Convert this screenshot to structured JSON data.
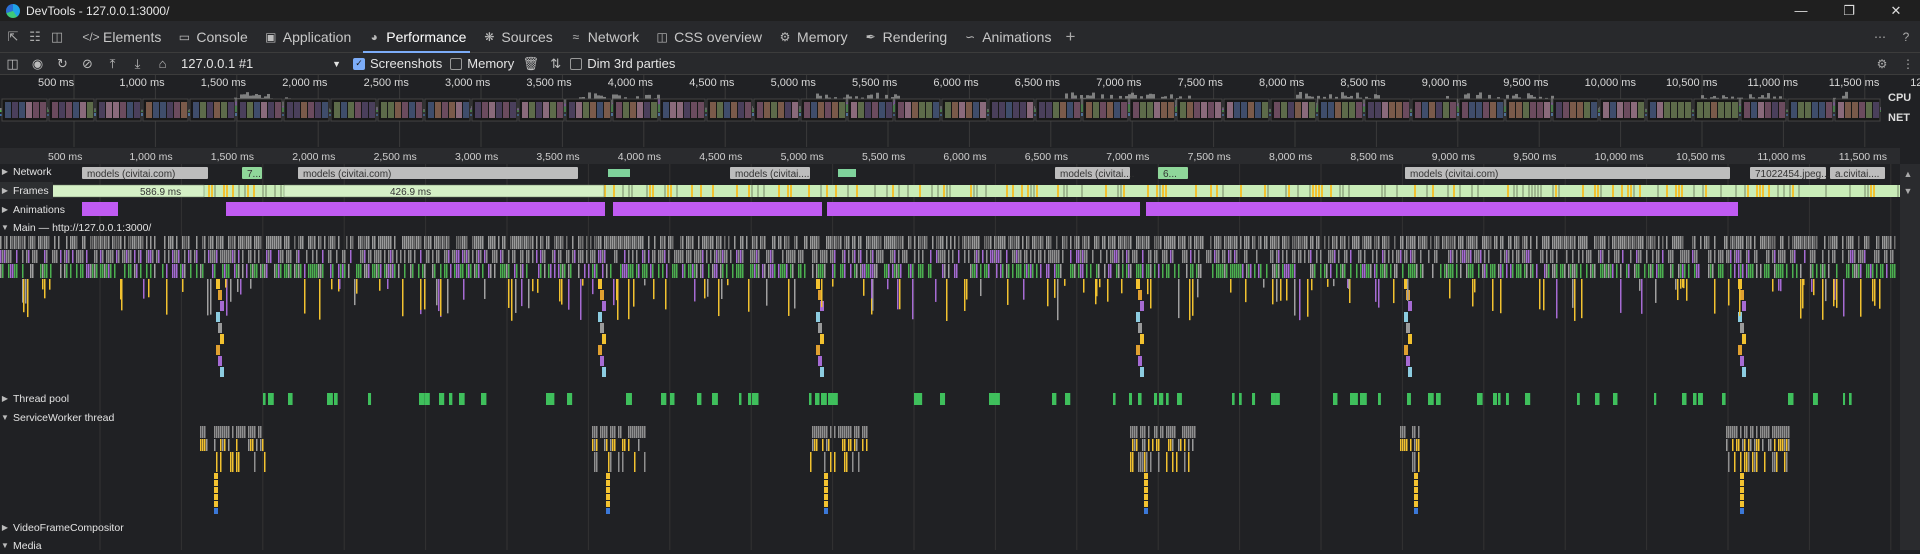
{
  "window": {
    "title": "DevTools - 127.0.0.1:3000/"
  },
  "tabs": [
    {
      "label": "Elements",
      "icon": "code-icon",
      "active": false
    },
    {
      "label": "Console",
      "icon": "console-icon",
      "active": false
    },
    {
      "label": "Application",
      "icon": "application-icon",
      "active": false
    },
    {
      "label": "Performance",
      "icon": "performance-icon",
      "active": true
    },
    {
      "label": "Sources",
      "icon": "bug-icon",
      "active": false
    },
    {
      "label": "Network",
      "icon": "wifi-icon",
      "active": false
    },
    {
      "label": "CSS overview",
      "icon": "css-overview-icon",
      "active": false
    },
    {
      "label": "Memory",
      "icon": "memory-icon",
      "active": false
    },
    {
      "label": "Rendering",
      "icon": "brush-icon",
      "active": false
    },
    {
      "label": "Animations",
      "icon": "animations-icon",
      "active": false
    }
  ],
  "toolbar": {
    "target": "127.0.0.1 #1",
    "screenshots_label": "Screenshots",
    "screenshots_checked": true,
    "memory_label": "Memory",
    "memory_checked": false,
    "dim_label": "Dim 3rd parties",
    "dim_checked": false
  },
  "overview": {
    "cpu_label": "CPU",
    "net_label": "NET",
    "ticks": [
      "500 ms",
      "1,000 ms",
      "1,500 ms",
      "2,000 ms",
      "2,500 ms",
      "3,000 ms",
      "3,500 ms",
      "4,000 ms",
      "4,500 ms",
      "5,000 ms",
      "5,500 ms",
      "6,000 ms",
      "6,500 ms",
      "7,000 ms",
      "7,500 ms",
      "8,000 ms",
      "8,500 ms",
      "9,000 ms",
      "9,500 ms",
      "10,000 ms",
      "10,500 ms",
      "11,000 ms",
      "11,500 ms",
      "12"
    ]
  },
  "tracks": {
    "network": {
      "label": "Network",
      "requests": [
        "models (civitai.com)",
        "7...",
        "models (civitai.com)",
        "models (civitai....",
        "models (civitai....",
        "6...",
        "models (civitai.com)",
        "71022454.jpeg....",
        "a.civitai...."
      ]
    },
    "frames": {
      "label": "Frames",
      "durations": [
        "586.9 ms",
        "426.9 ms"
      ]
    },
    "animations": {
      "label": "Animations"
    },
    "main": {
      "label": "Main — http://127.0.0.1:3000/"
    },
    "thread_pool": {
      "label": "Thread pool"
    },
    "service_worker": {
      "label": "ServiceWorker thread"
    },
    "video_frame": {
      "label": "VideoFrameCompositor"
    },
    "media": {
      "label": "Media"
    }
  },
  "colors": {
    "scripting": "#f2c230",
    "rendering": "#a66bd3",
    "painting": "#4caf50",
    "system": "#8f8f8f",
    "animation_bar": "#c05bf2",
    "frame_fill": "#d5f0c6",
    "accent": "#7cacf8"
  }
}
